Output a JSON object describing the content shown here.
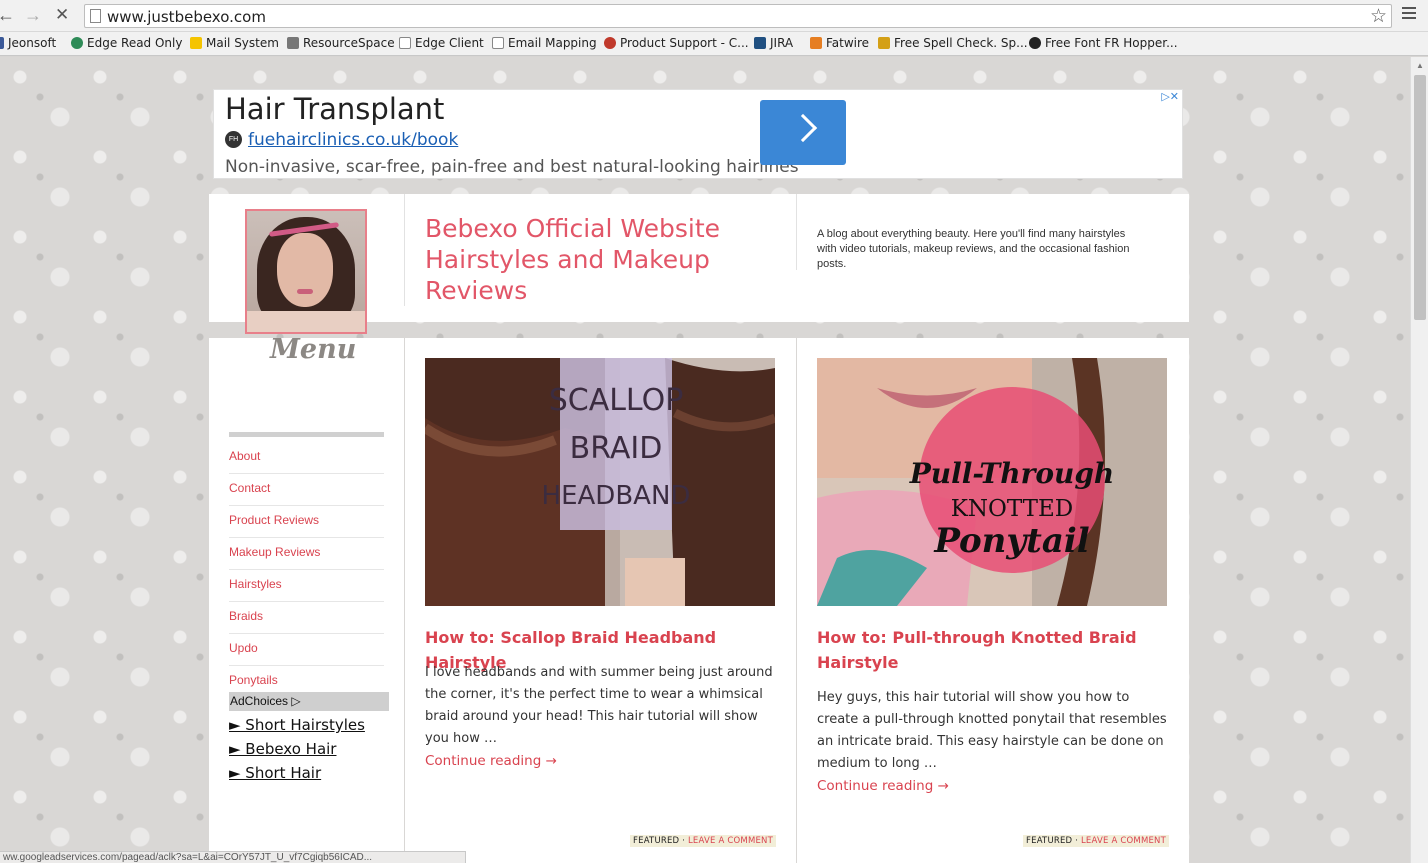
{
  "browser": {
    "url": "www.justbebexo.com",
    "bookmarks": [
      {
        "label": "Jeonsoft",
        "color": "#3b5998"
      },
      {
        "label": "Edge Read Only",
        "color": "#2e8b57"
      },
      {
        "label": "Mail System",
        "color": "#f5c400"
      },
      {
        "label": "ResourceSpace",
        "color": "#777777"
      },
      {
        "label": "Edge Client",
        "color": "#ffffff"
      },
      {
        "label": "Email Mapping",
        "color": "#ffffff"
      },
      {
        "label": "Product Support - C...",
        "color": "#c0392b"
      },
      {
        "label": "JIRA",
        "color": "#205081"
      },
      {
        "label": "Fatwire",
        "color": "#e67e22"
      },
      {
        "label": "Free Spell Check. Sp...",
        "color": "#d4a017"
      },
      {
        "label": "Free Font FR Hopper...",
        "color": "#222222"
      }
    ],
    "status_url": "ww.googleadservices.com/pagead/aclk?sa=L&ai=COrY57JT_U_vf7Cgiqb56ICAD..."
  },
  "ad": {
    "title": "Hair Transplant",
    "logo_text": "FH",
    "url": "fuehairclinics.co.uk/book",
    "description": "Non-invasive, scar-free, pain-free and best natural-looking hairlines",
    "adchoice_icon": "ad-choices-icon"
  },
  "header": {
    "title": "Bebexo Official Website Hairstyles and Makeup Reviews",
    "description": "A blog about everything beauty. Here you'll find many hairstyles with video tutorials, makeup reviews, and the occasional fashion posts.",
    "menu_label": "Menu"
  },
  "sidebar": {
    "items": [
      {
        "label": "About"
      },
      {
        "label": "Contact"
      },
      {
        "label": "Product Reviews"
      },
      {
        "label": "Makeup Reviews"
      },
      {
        "label": "Hairstyles"
      },
      {
        "label": "Braids"
      },
      {
        "label": "Updo"
      },
      {
        "label": "Ponytails"
      }
    ],
    "adchoices_label": "AdChoices ▷",
    "ad_links": [
      {
        "label": "► Short Hairstyles"
      },
      {
        "label": "► Bebexo Hair"
      },
      {
        "label": "► Short Hair"
      }
    ]
  },
  "posts": [
    {
      "image_text": [
        "SCALLOP",
        "BRAID",
        "HEADBAND"
      ],
      "title": "How to: Scallop Braid Headband Hairstyle",
      "excerpt": "I love headbands and with summer being just around the corner, it's the perfect time to wear a whimsical  braid around your head! This hair tutorial will show you how …",
      "continue": "Continue reading →",
      "meta_featured": "FEATURED",
      "meta_sep": " · ",
      "meta_comment": "LEAVE A COMMENT"
    },
    {
      "image_text": [
        "Pull-Through",
        "KNOTTED",
        "Ponytail"
      ],
      "title": "How to: Pull-through Knotted Braid Hairstyle",
      "excerpt": "Hey guys, this hair tutorial will  show you how to create a pull-through knotted ponytail that resembles an intricate braid. This easy hairstyle can be done on medium to long …",
      "continue": "Continue reading →",
      "meta_featured": "FEATURED",
      "meta_sep": " · ",
      "meta_comment": "LEAVE A COMMENT"
    }
  ],
  "colors": {
    "accent": "#e25668",
    "link": "#d9434f"
  }
}
